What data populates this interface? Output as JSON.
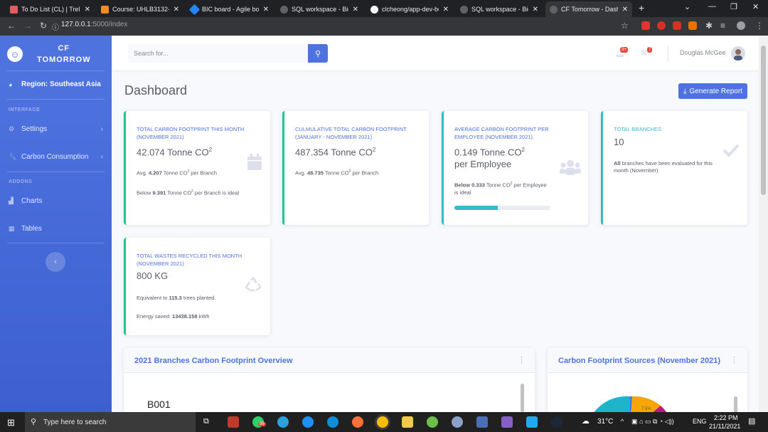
{
  "browser": {
    "tabs": [
      {
        "label": "To Do List (CL) | Trello",
        "color": "#e05d5d"
      },
      {
        "label": "Course: UHLB3132-40",
        "color": "#f58a1f"
      },
      {
        "label": "BIC board - Agile boa",
        "color": "#2684ff"
      },
      {
        "label": "SQL workspace - Big",
        "color": "#9aa0a6"
      },
      {
        "label": "clcheong/app-dev-bc",
        "color": "#ffffff"
      },
      {
        "label": "SQL workspace - Big",
        "color": "#9aa0a6"
      },
      {
        "label": "CF Tomorrow - Dashb",
        "color": "#9aa0a6"
      }
    ],
    "url_host": "127.0.0.1",
    "url_path": ":5000/index"
  },
  "sidebar": {
    "brand_line1": "CF",
    "brand_line2": "TOMORROW",
    "region": "Region: Southeast Asia",
    "heading_interface": "INTERFACE",
    "settings": "Settings",
    "carbon": "Carbon Consumption",
    "heading_addons": "ADDONS",
    "charts": "Charts",
    "tables": "Tables"
  },
  "topbar": {
    "search_placeholder": "Search for...",
    "alerts_badge": "3+",
    "messages_badge": "7",
    "user_name": "Douglas McGee"
  },
  "page": {
    "title": "Dashboard",
    "generate_report": "Generate Report"
  },
  "cards": {
    "c1": {
      "title": "TOTAL CARBON FOOTPRINT THIS MONTH (NOVEMBER 2021)",
      "value": "42.074 Tonne CO",
      "avg_prefix": "Avg.",
      "avg_value": "4.207",
      "avg_suffix": "Tonne CO",
      "avg_tail": "per Branch",
      "below_prefix": "Below",
      "below_value": "9.391",
      "below_suffix": "Tonne CO",
      "below_tail": "per Branch is ideal"
    },
    "c2": {
      "title": "CULMULATIVE TOTAL CARBON FOOTPRINT (JANUARY - NOVEMBER 2021)",
      "value": "487.354 Tonne CO",
      "avg_prefix": "Avg.",
      "avg_value": "48.735",
      "avg_suffix": "Tonne CO",
      "avg_tail": "per Branch"
    },
    "c3": {
      "title": "AVERAGE CARBON FOOTPRINT PER EMPLOYEE (NOVEMBER 2021)",
      "value_line1": "0.149 Tonne CO",
      "value_line2": "per Employee",
      "below_value": "Below 0.333",
      "below_suffix": "Tonne CO",
      "below_tail": "per Employee is ideal",
      "progress": 0.45
    },
    "c4": {
      "title": "TOTAL BRANCHES",
      "value": "10",
      "note_bold": "All",
      "note": "branches have been evaluated for this month (November)"
    },
    "c5": {
      "title": "TOTAL WASTES RECYCLED THIS MONTH (NOVEMBER 2021)",
      "value": "800 KG",
      "equiv_prefix": "Equivalent to",
      "equiv_value": "115.3",
      "equiv_suffix": "trees planted.",
      "energy_prefix": "Energy saved:",
      "energy_value": "13438.158",
      "energy_suffix": "kWh"
    }
  },
  "panels": {
    "overview_title": "2021 Branches Carbon Footprint Overview",
    "overview_first_label": "B001",
    "sources_title": "Carbon Footprint Sources (November 2021)",
    "pie_label": "7.5%"
  },
  "taskbar": {
    "search": "Type here to search",
    "temp": "31°C",
    "lang": "ENG",
    "time": "2:22 PM",
    "date": "21/11/2021",
    "whatsapp_badge": "99"
  },
  "colors": {
    "primary": "#4e73df",
    "success": "#1cc88a",
    "info": "#36b9cc"
  }
}
